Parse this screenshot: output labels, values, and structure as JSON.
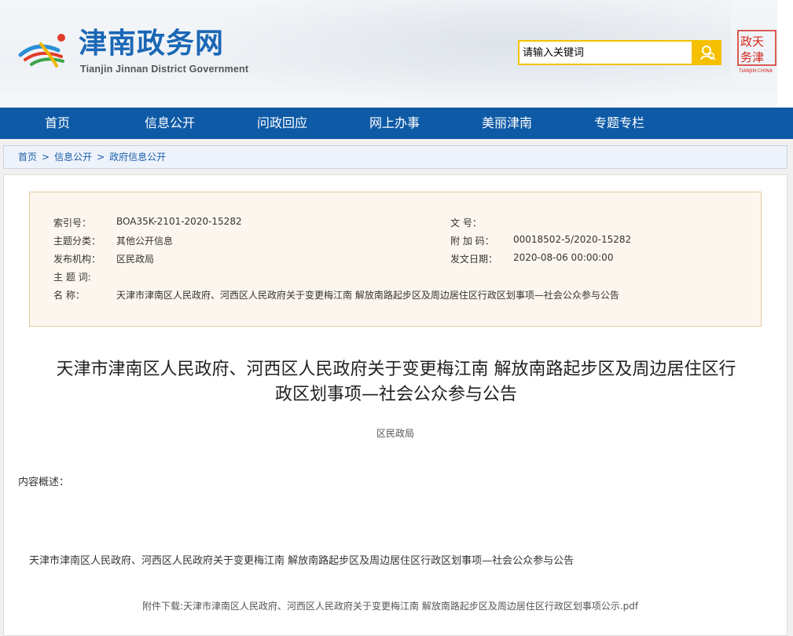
{
  "header": {
    "site_title": "津南政务网",
    "site_subtitle": "Tianjin Jinnan District Government",
    "search_placeholder": "请输入关键词",
    "seal_caption": "TIANJIN·CHINA"
  },
  "nav": {
    "items": [
      "首页",
      "信息公开",
      "问政回应",
      "网上办事",
      "美丽津南",
      "专题专栏"
    ]
  },
  "breadcrumb": {
    "items": [
      "首页",
      "信息公开",
      "政府信息公开"
    ],
    "separator": ">"
  },
  "meta": {
    "index_label": "索引号：",
    "index_value": "BOA35K-2101-2020-15282",
    "doc_no_label": "文 号：",
    "doc_no_value": "",
    "category_label": "主题分类：",
    "category_value": "其他公开信息",
    "attach_no_label": "附 加 码：",
    "attach_no_value": "00018502-5/2020-15282",
    "publisher_label": "发布机构：",
    "publisher_value": "区民政局",
    "date_label": "发文日期：",
    "date_value": "2020-08-06 00:00:00",
    "keywords_label": "主 题 词:",
    "keywords_value": "",
    "name_label": "名 称：",
    "name_value": "天津市津南区人民政府、河西区人民政府关于变更梅江南 解放南路起步区及周边居住区行政区划事项—社会公众参与公告"
  },
  "article": {
    "title_line1": "天津市津南区人民政府、河西区人民政府关于变更梅江南 解放南路起步区及周边居住区行",
    "title_line2": "政区划事项—社会公众参与公告",
    "organization": "区民政局",
    "summary_label": "内容概述：",
    "body": "天津市津南区人民政府、河西区人民政府关于变更梅江南 解放南路起步区及周边居住区行政区划事项—社会公众参与公告",
    "attachment": "附件下载:天津市津南区人民政府、河西区人民政府关于变更梅江南 解放南路起步区及周边居住区行政区划事项公示.pdf"
  },
  "colors": {
    "brand_blue": "#1b67b6",
    "nav_blue": "#0e5aa6",
    "search_yellow": "#f5c000",
    "seal_red": "#d4281e",
    "meta_bg": "#fdf6ee"
  },
  "icons": [
    "logo-icon",
    "search-icon",
    "seal-icon"
  ]
}
